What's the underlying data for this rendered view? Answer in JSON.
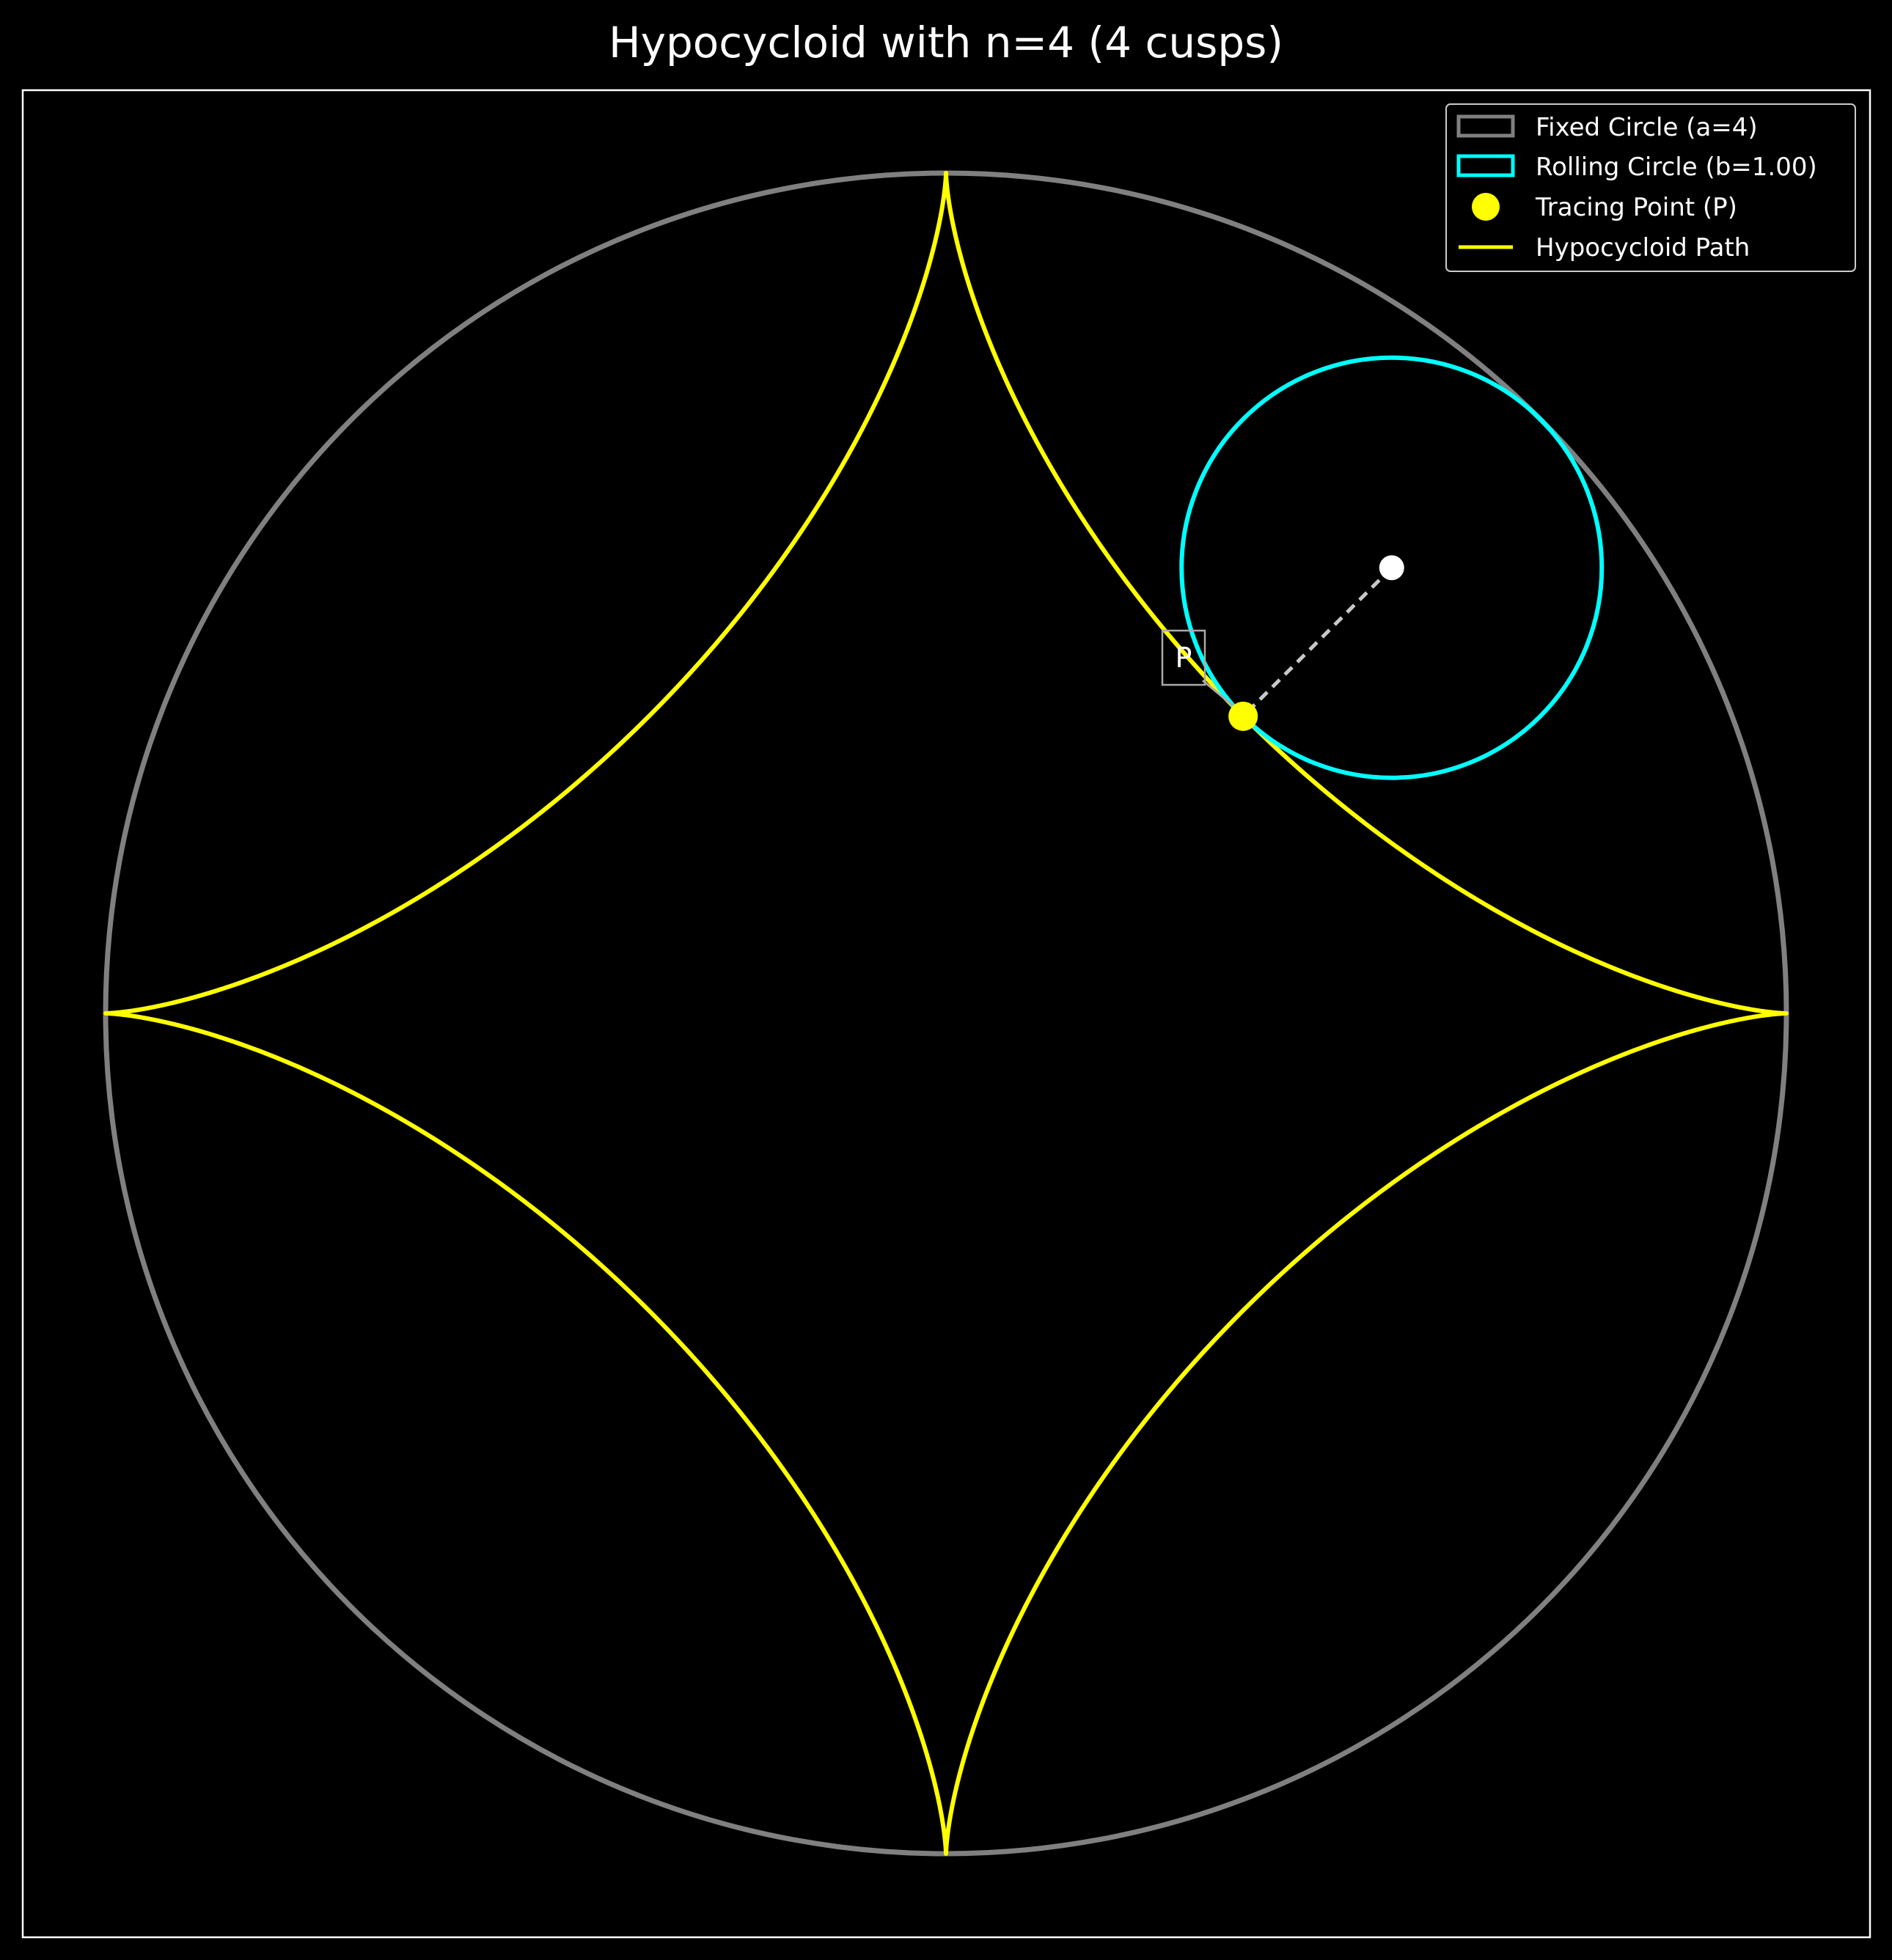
{
  "figure": {
    "title": "Hypocycloid with n=4 (4 cusps)"
  },
  "geometry": {
    "fixed_radius": 4,
    "rolling_radius": 1.0,
    "n_cusps": 4,
    "rolling_angle_deg": 45,
    "xlim": [
      -4.2,
      4.2
    ],
    "ylim": [
      -4.2,
      4.2
    ]
  },
  "colors": {
    "background": "#000000",
    "fixed_circle": "#808080",
    "rolling_circle": "#00ffff",
    "tracing_point": "#ffff00",
    "hypocycloid_path": "#ffff00",
    "center_point": "#ffffff",
    "radius_line": "#c8c8c8",
    "frame": "#ffffff"
  },
  "legend": {
    "placement": "upper right",
    "items": [
      {
        "label": "Fixed Circle (a=4)",
        "color": "#808080",
        "marker": "rect"
      },
      {
        "label": "Rolling Circle (b=1.00)",
        "color": "#00ffff",
        "marker": "rect"
      },
      {
        "label": "Tracing Point (P)",
        "color": "#ffff00",
        "marker": "dot"
      },
      {
        "label": "Hypocycloid Path",
        "color": "#ffff00",
        "marker": "line"
      }
    ]
  },
  "annotations": {
    "tracing_point_label": "P"
  }
}
